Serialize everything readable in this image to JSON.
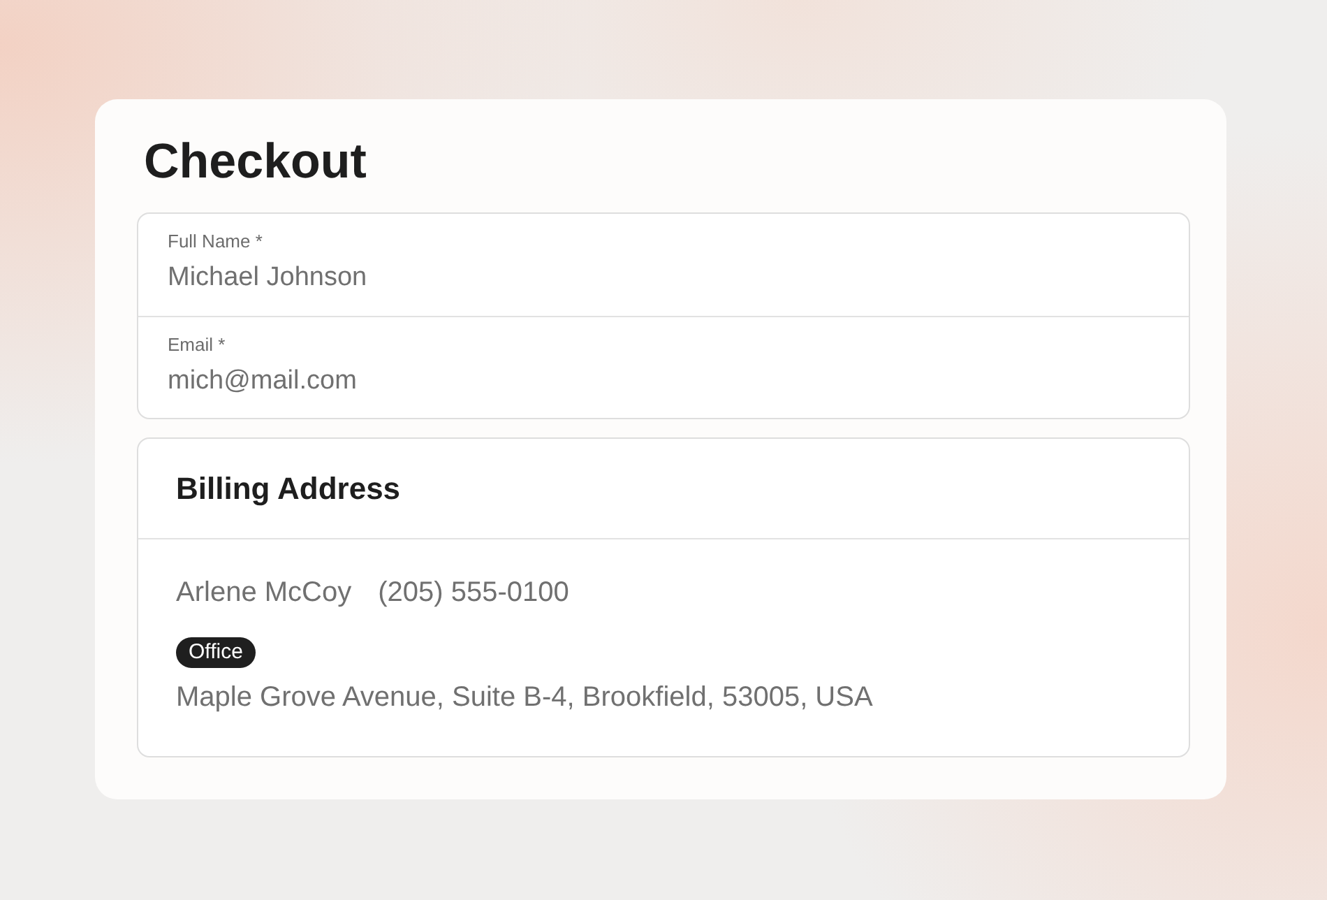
{
  "page": {
    "title": "Checkout"
  },
  "contact_fields": [
    {
      "label": "Full Name *",
      "value": "Michael Johnson"
    },
    {
      "label": "Email *",
      "value": "mich@mail.com"
    }
  ],
  "billing_address": {
    "title": "Billing Address",
    "name": "Arlene McCoy",
    "phone": "(205) 555-0100",
    "tag": "Office",
    "address": "Maple Grove Avenue, Suite B-4, Brookfield, 53005, USA"
  }
}
